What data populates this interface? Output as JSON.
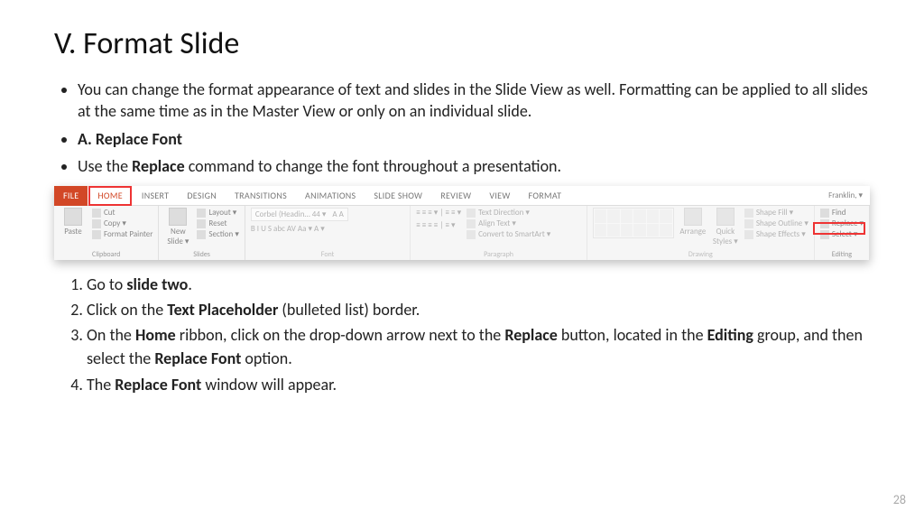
{
  "title": "V. Format Slide",
  "bullets": [
    {
      "html_parts": [
        [
          "You can change the format appearance of text and slides in the Slide View as well. Formatting can be applied to all slides at the same time as in the Master View or only on an individual slide.",
          false
        ]
      ]
    },
    {
      "html_parts": [
        [
          "A. Replace Font",
          true
        ]
      ]
    },
    {
      "html_parts": [
        [
          "Use the ",
          false
        ],
        [
          "Replace",
          true
        ],
        [
          " command to change the font throughout a presentation.",
          false
        ]
      ]
    }
  ],
  "ribbon": {
    "tabs": [
      "FILE",
      "HOME",
      "INSERT",
      "DESIGN",
      "TRANSITIONS",
      "ANIMATIONS",
      "SLIDE SHOW",
      "REVIEW",
      "VIEW",
      "FORMAT"
    ],
    "highlight_tab": "HOME",
    "user_label": "Franklin, ▾",
    "groups": {
      "clipboard": {
        "label": "Clipboard",
        "paste": "Paste",
        "items": [
          "Cut",
          "Copy ▾",
          "Format Painter"
        ]
      },
      "slides": {
        "label": "Slides",
        "new": "New\nSlide ▾",
        "items": [
          "Layout ▾",
          "Reset",
          "Section ▾"
        ]
      },
      "font": {
        "label": "Font",
        "font_box": "Corbel (Headin…  44  ▾",
        "row": "B  I  U  S  abc  AV  Aa ▾  A ▾"
      },
      "paragraph": {
        "label": "Paragraph",
        "items": [
          "Text Direction ▾",
          "Align Text ▾",
          "Convert to SmartArt ▾"
        ]
      },
      "drawing": {
        "label": "Drawing",
        "arrange": "Arrange",
        "quick": "Quick\nStyles ▾",
        "items": [
          "Shape Fill ▾",
          "Shape Outline ▾",
          "Shape Effects ▾"
        ]
      },
      "editing": {
        "label": "Editing",
        "items": [
          "Find",
          "Replace ▾",
          "Select ▾"
        ]
      }
    }
  },
  "steps": [
    [
      [
        "Go to ",
        false
      ],
      [
        "slide two",
        true
      ],
      [
        ".",
        false
      ]
    ],
    [
      [
        "Click on the ",
        false
      ],
      [
        "Text Placeholder",
        true
      ],
      [
        " (bulleted list) border.",
        false
      ]
    ],
    [
      [
        "On the ",
        false
      ],
      [
        "Home",
        true
      ],
      [
        " ribbon, click on the drop-down arrow next to the ",
        false
      ],
      [
        "Replace",
        true
      ],
      [
        " button, located in the ",
        false
      ],
      [
        "Editing",
        true
      ],
      [
        " group, and then select the ",
        false
      ],
      [
        "Replace Font",
        true
      ],
      [
        " option.",
        false
      ]
    ],
    [
      [
        "The ",
        false
      ],
      [
        "Replace Font",
        true
      ],
      [
        " window will appear.",
        false
      ]
    ]
  ],
  "page_number": "28"
}
